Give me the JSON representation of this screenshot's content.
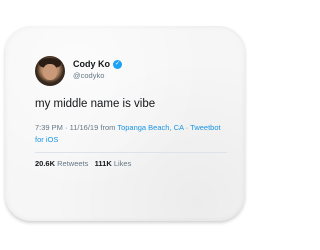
{
  "tweet": {
    "display_name": "Cody Ko",
    "handle": "@codyko",
    "text": "my middle name is vibe",
    "time": "7:39 PM",
    "date": "11/16/19",
    "from_label": "from",
    "location": "Topanga Beach, CA",
    "via_label": "Tweetbot",
    "via_suffix": "for iOS",
    "retweets_count": "20.6K",
    "retweets_label": "Retweets",
    "likes_count": "111K",
    "likes_label": "Likes"
  },
  "colors": {
    "link": "#1b95e0",
    "verified": "#1da1f2",
    "muted_text": "#657786",
    "main_text": "#14171a",
    "mat": "#f6f6f6"
  },
  "icons": {
    "verified": "verified-badge-icon"
  }
}
